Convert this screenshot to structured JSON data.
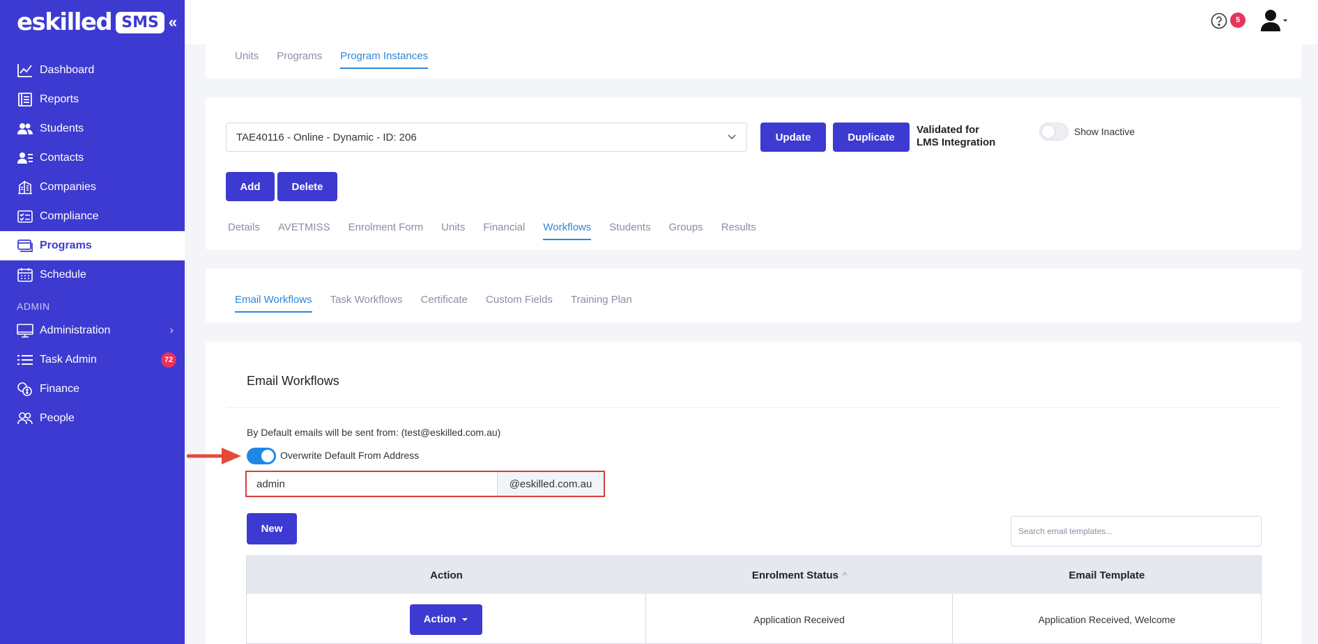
{
  "app": {
    "logo_text": "eskilled",
    "logo_badge": "SMS",
    "collapse_glyph": "«"
  },
  "sidebar": {
    "items": [
      {
        "label": "Dashboard",
        "icon": "chart-line-icon"
      },
      {
        "label": "Reports",
        "icon": "report-icon"
      },
      {
        "label": "Students",
        "icon": "users-icon"
      },
      {
        "label": "Contacts",
        "icon": "contacts-icon"
      },
      {
        "label": "Companies",
        "icon": "building-icon"
      },
      {
        "label": "Compliance",
        "icon": "checklist-icon"
      },
      {
        "label": "Programs",
        "icon": "programs-icon",
        "active": true
      },
      {
        "label": "Schedule",
        "icon": "calendar-icon"
      }
    ],
    "admin_section_label": "ADMIN",
    "admin_items": [
      {
        "label": "Administration",
        "icon": "monitor-icon",
        "chevron": "›"
      },
      {
        "label": "Task Admin",
        "icon": "list-icon",
        "badge": "72"
      },
      {
        "label": "Finance",
        "icon": "coins-icon"
      },
      {
        "label": "People",
        "icon": "people-icon"
      }
    ]
  },
  "topbar": {
    "help_badge": "5"
  },
  "top_tabs": [
    "Units",
    "Programs",
    "Program Instances"
  ],
  "program_card": {
    "selected_instance": "TAE40116 - Online - Dynamic - ID: 206",
    "update_label": "Update",
    "duplicate_label": "Duplicate",
    "lms_label": "Validated for LMS Integration",
    "show_inactive_label": "Show Inactive",
    "add_label": "Add",
    "delete_label": "Delete",
    "tabs": [
      "Details",
      "AVETMISS",
      "Enrolment Form",
      "Units",
      "Financial",
      "Workflows",
      "Students",
      "Groups",
      "Results"
    ]
  },
  "workflow_tabs": [
    "Email Workflows",
    "Task Workflows",
    "Certificate",
    "Custom Fields",
    "Training Plan"
  ],
  "email_workflows": {
    "title": "Email Workflows",
    "default_from_text": "By Default emails will be sent from: (test@eskilled.com.au)",
    "overwrite_label": "Overwrite Default From Address",
    "from_value": "admin",
    "from_domain": "@eskilled.com.au",
    "new_label": "New",
    "search_placeholder": "Search email templates...",
    "table": {
      "headers": [
        "Action",
        "Enrolment Status",
        "Email Template"
      ],
      "sort_indicator": "^",
      "rows": [
        {
          "action_label": "Action",
          "status": "Application Received",
          "template": "Application Received, Welcome"
        }
      ]
    }
  },
  "colors": {
    "sidebar_bg": "#3d3ad1",
    "primary_button": "#3d3ad1",
    "active_tab": "#2f86d8",
    "badge": "#e8335c",
    "highlight_border": "#d83b3b",
    "toggle_on": "#1e88e5"
  }
}
